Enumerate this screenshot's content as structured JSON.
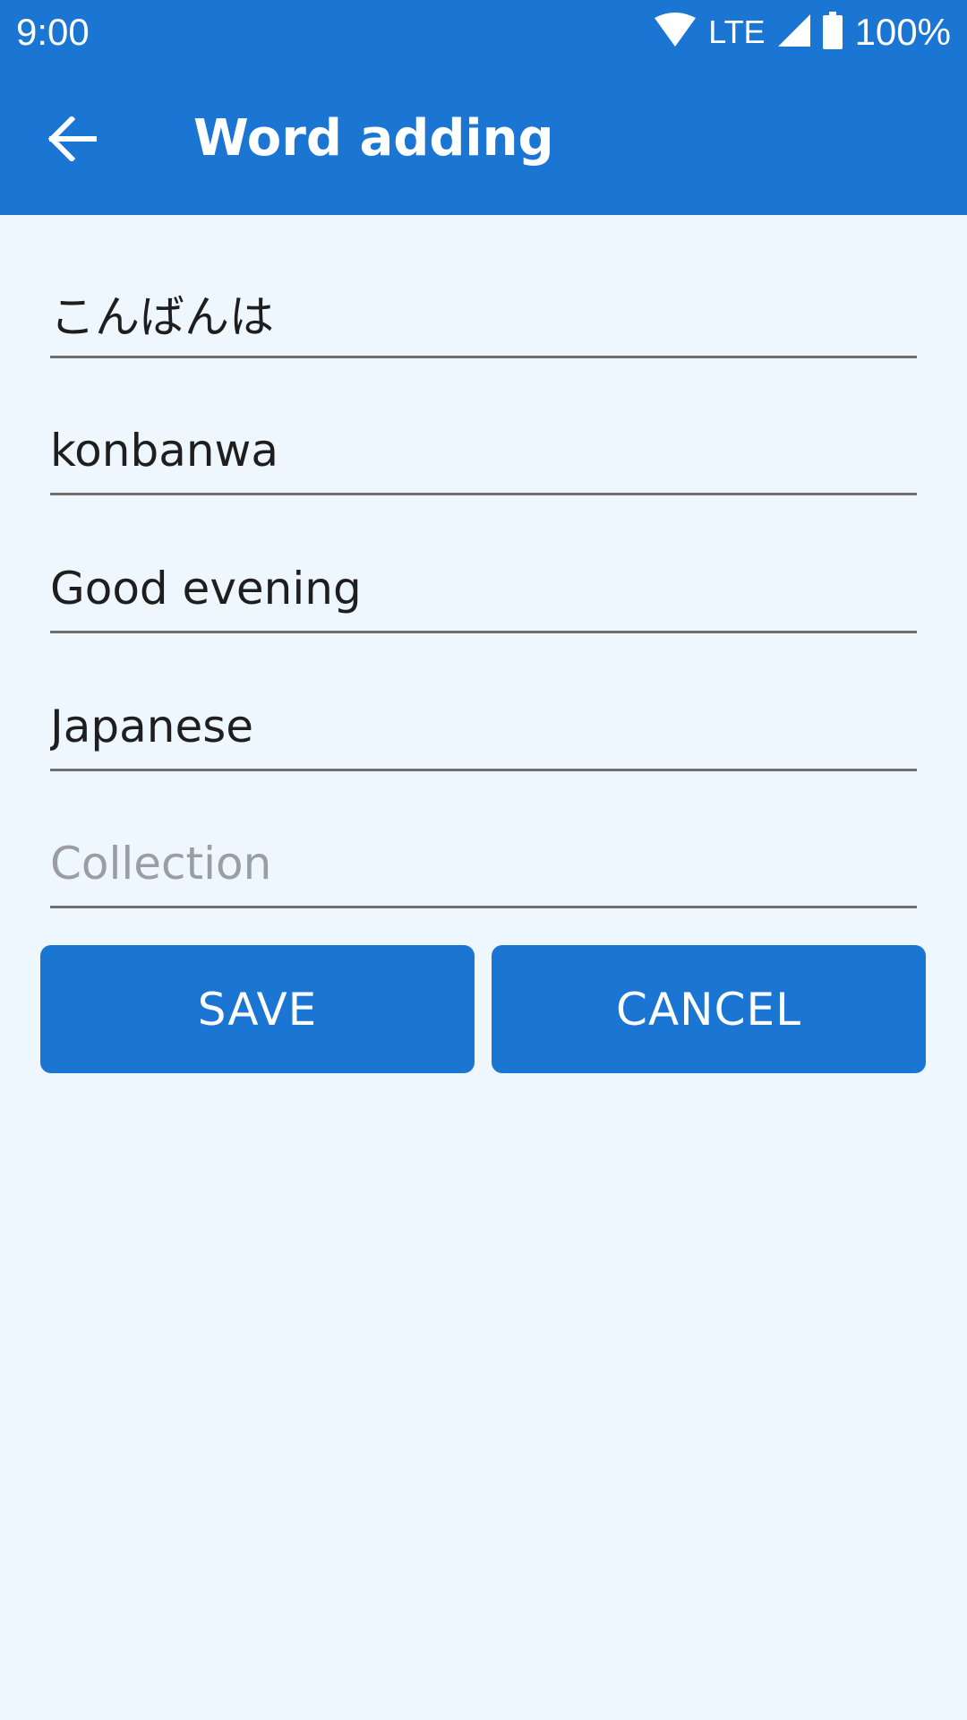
{
  "status_bar": {
    "time": "9:00",
    "network_label": "LTE",
    "battery_text": "100%",
    "icons": [
      "wifi-icon",
      "cell-signal-icon",
      "battery-icon"
    ]
  },
  "app_bar": {
    "title": "Word adding",
    "back_icon": "arrow-back-icon",
    "background_color": "#1b76d3"
  },
  "form": {
    "fields": [
      {
        "name": "word",
        "value": "こんばんは",
        "placeholder": ""
      },
      {
        "name": "transcription",
        "value": "konbanwa",
        "placeholder": ""
      },
      {
        "name": "translation",
        "value": "Good evening",
        "placeholder": ""
      },
      {
        "name": "language",
        "value": "Japanese",
        "placeholder": ""
      },
      {
        "name": "collection",
        "value": "",
        "placeholder": "Collection"
      }
    ]
  },
  "buttons": {
    "save_label": "SAVE",
    "cancel_label": "CANCEL"
  },
  "colors": {
    "accent": "#1b76d3",
    "background": "#eef6fe",
    "text": "#1e1e1e",
    "placeholder": "#9a9ea3"
  }
}
